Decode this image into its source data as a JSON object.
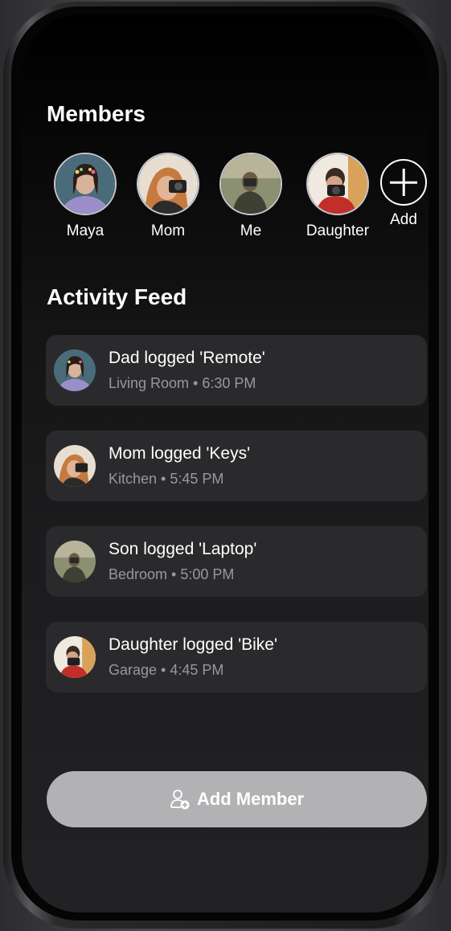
{
  "colors": {
    "screen_background": "#000000",
    "card_background": "#2a2a2c",
    "primary_text": "#ffffff",
    "secondary_text": "#98989d",
    "button_background": "#b2b2b4"
  },
  "members_section": {
    "title": "Members",
    "members": [
      {
        "name": "Maya",
        "avatar": "avatar-photo-maya"
      },
      {
        "name": "Mom",
        "avatar": "avatar-photo-mom"
      },
      {
        "name": "Me",
        "avatar": "avatar-photo-me"
      },
      {
        "name": "Daughter",
        "avatar": "avatar-photo-daughter"
      }
    ],
    "add": {
      "label": "Add",
      "icon": "plus-circle-icon"
    }
  },
  "activity_feed": {
    "title": "Activity Feed",
    "items": [
      {
        "title": "Dad logged 'Remote'",
        "subtitle": "Living Room • 6:30 PM"
      },
      {
        "title": "Mom logged 'Keys'",
        "subtitle": "Kitchen • 5:45 PM"
      },
      {
        "title": "Son logged 'Laptop'",
        "subtitle": "Bedroom • 5:00 PM"
      },
      {
        "title": "Daughter logged 'Bike'",
        "subtitle": "Garage • 4:45 PM"
      }
    ]
  },
  "add_member_button": {
    "label": "Add Member",
    "icon": "person-add-icon"
  }
}
